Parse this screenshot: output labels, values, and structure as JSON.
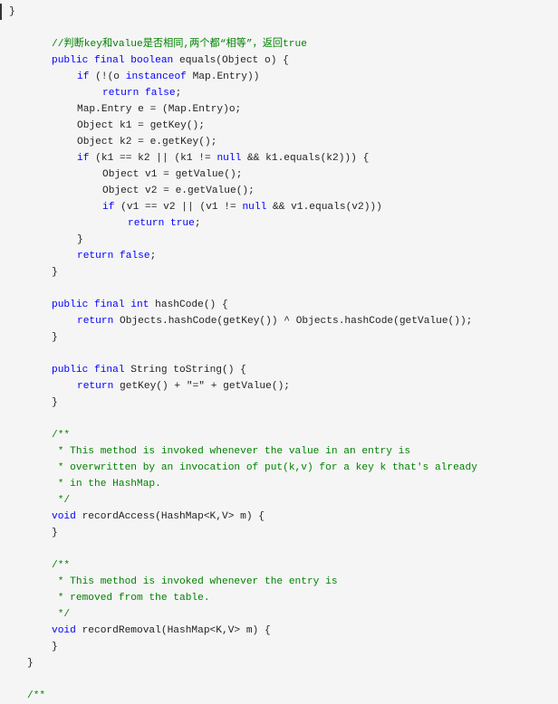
{
  "code": {
    "language": "java",
    "colors": {
      "background": "#f5f5f5",
      "keyword": "#0000ff",
      "comment": "#008200",
      "plain": "#222222"
    },
    "lines": [
      {
        "indent": 0,
        "tokens": [
          {
            "t": "pl",
            "v": "}"
          }
        ],
        "x": 10
      },
      {
        "indent": 0,
        "tokens": []
      },
      {
        "indent": 2,
        "tokens": [
          {
            "t": "cm",
            "v": "//判断key和value是否相同,两个都“相等”，返回true"
          }
        ]
      },
      {
        "indent": 2,
        "tokens": [
          {
            "t": "kw",
            "v": "public final boolean"
          },
          {
            "t": "pl",
            "v": " equals(Object o) {"
          }
        ]
      },
      {
        "indent": 3,
        "tokens": [
          {
            "t": "kw",
            "v": "if"
          },
          {
            "t": "pl",
            "v": " (!(o "
          },
          {
            "t": "kw",
            "v": "instanceof"
          },
          {
            "t": "pl",
            "v": " Map.Entry))"
          }
        ]
      },
      {
        "indent": 4,
        "tokens": [
          {
            "t": "kw",
            "v": "return false"
          },
          {
            "t": "pl",
            "v": ";"
          }
        ]
      },
      {
        "indent": 3,
        "tokens": [
          {
            "t": "pl",
            "v": "Map.Entry e = (Map.Entry)o;"
          }
        ]
      },
      {
        "indent": 3,
        "tokens": [
          {
            "t": "pl",
            "v": "Object k1 = getKey();"
          }
        ]
      },
      {
        "indent": 3,
        "tokens": [
          {
            "t": "pl",
            "v": "Object k2 = e.getKey();"
          }
        ]
      },
      {
        "indent": 3,
        "tokens": [
          {
            "t": "kw",
            "v": "if"
          },
          {
            "t": "pl",
            "v": " (k1 == k2 || (k1 != "
          },
          {
            "t": "kw",
            "v": "null"
          },
          {
            "t": "pl",
            "v": " && k1.equals(k2))) {"
          }
        ]
      },
      {
        "indent": 4,
        "tokens": [
          {
            "t": "pl",
            "v": "Object v1 = getValue();"
          }
        ]
      },
      {
        "indent": 4,
        "tokens": [
          {
            "t": "pl",
            "v": "Object v2 = e.getValue();"
          }
        ]
      },
      {
        "indent": 4,
        "tokens": [
          {
            "t": "kw",
            "v": "if"
          },
          {
            "t": "pl",
            "v": " (v1 == v2 || (v1 != "
          },
          {
            "t": "kw",
            "v": "null"
          },
          {
            "t": "pl",
            "v": " && v1.equals(v2)))"
          }
        ]
      },
      {
        "indent": 5,
        "tokens": [
          {
            "t": "kw",
            "v": "return true"
          },
          {
            "t": "pl",
            "v": ";"
          }
        ]
      },
      {
        "indent": 3,
        "tokens": [
          {
            "t": "pl",
            "v": "}"
          }
        ]
      },
      {
        "indent": 3,
        "tokens": [
          {
            "t": "kw",
            "v": "return false"
          },
          {
            "t": "pl",
            "v": ";"
          }
        ]
      },
      {
        "indent": 2,
        "tokens": [
          {
            "t": "pl",
            "v": "}"
          }
        ]
      },
      {
        "indent": 0,
        "tokens": []
      },
      {
        "indent": 2,
        "tokens": [
          {
            "t": "kw",
            "v": "public final int"
          },
          {
            "t": "pl",
            "v": " hashCode() {"
          }
        ]
      },
      {
        "indent": 3,
        "tokens": [
          {
            "t": "kw",
            "v": "return"
          },
          {
            "t": "pl",
            "v": " Objects.hashCode(getKey()) ^ Objects.hashCode(getValue());"
          }
        ]
      },
      {
        "indent": 2,
        "tokens": [
          {
            "t": "pl",
            "v": "}"
          }
        ]
      },
      {
        "indent": 0,
        "tokens": []
      },
      {
        "indent": 2,
        "tokens": [
          {
            "t": "kw",
            "v": "public final"
          },
          {
            "t": "pl",
            "v": " String toString() {"
          }
        ]
      },
      {
        "indent": 3,
        "tokens": [
          {
            "t": "kw",
            "v": "return"
          },
          {
            "t": "pl",
            "v": " getKey() + \"=\" + getValue();"
          }
        ]
      },
      {
        "indent": 2,
        "tokens": [
          {
            "t": "pl",
            "v": "}"
          }
        ]
      },
      {
        "indent": 0,
        "tokens": []
      },
      {
        "indent": 2,
        "tokens": [
          {
            "t": "cm",
            "v": "/**"
          }
        ]
      },
      {
        "indent": 2,
        "tokens": [
          {
            "t": "cm",
            "v": " * This method is invoked whenever the value in an entry is"
          }
        ]
      },
      {
        "indent": 2,
        "tokens": [
          {
            "t": "cm",
            "v": " * overwritten by an invocation of put(k,v) for a key k that's already"
          }
        ]
      },
      {
        "indent": 2,
        "tokens": [
          {
            "t": "cm",
            "v": " * in the HashMap."
          }
        ]
      },
      {
        "indent": 2,
        "tokens": [
          {
            "t": "cm",
            "v": " */"
          }
        ]
      },
      {
        "indent": 2,
        "tokens": [
          {
            "t": "kw",
            "v": "void"
          },
          {
            "t": "pl",
            "v": " recordAccess(HashMap<K,V> m) {"
          }
        ]
      },
      {
        "indent": 2,
        "tokens": [
          {
            "t": "pl",
            "v": "}"
          }
        ]
      },
      {
        "indent": 0,
        "tokens": []
      },
      {
        "indent": 2,
        "tokens": [
          {
            "t": "cm",
            "v": "/**"
          }
        ]
      },
      {
        "indent": 2,
        "tokens": [
          {
            "t": "cm",
            "v": " * This method is invoked whenever the entry is"
          }
        ]
      },
      {
        "indent": 2,
        "tokens": [
          {
            "t": "cm",
            "v": " * removed from the table."
          }
        ]
      },
      {
        "indent": 2,
        "tokens": [
          {
            "t": "cm",
            "v": " */"
          }
        ]
      },
      {
        "indent": 2,
        "tokens": [
          {
            "t": "kw",
            "v": "void"
          },
          {
            "t": "pl",
            "v": " recordRemoval(HashMap<K,V> m) {"
          }
        ]
      },
      {
        "indent": 2,
        "tokens": [
          {
            "t": "pl",
            "v": "}"
          }
        ]
      },
      {
        "indent": 1,
        "tokens": [
          {
            "t": "pl",
            "v": "}"
          }
        ]
      },
      {
        "indent": 0,
        "tokens": []
      },
      {
        "indent": 1,
        "tokens": [
          {
            "t": "cm",
            "v": "/**"
          }
        ]
      }
    ]
  }
}
